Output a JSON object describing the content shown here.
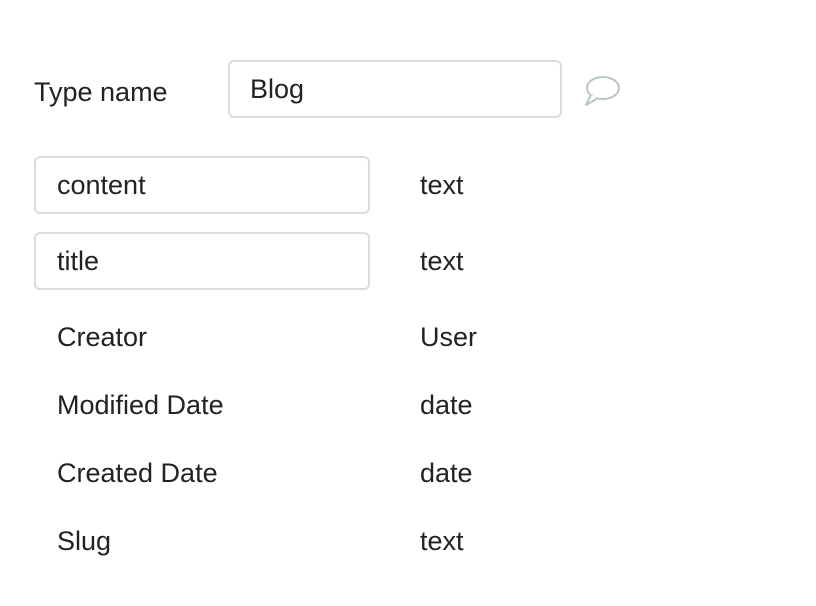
{
  "type_name": {
    "label": "Type name",
    "value": "Blog"
  },
  "icons": {
    "comment": "speech-bubble-icon"
  },
  "editable_fields": [
    {
      "name": "content",
      "type": "text"
    },
    {
      "name": "title",
      "type": "text"
    }
  ],
  "builtin_fields": [
    {
      "name": "Creator",
      "type": "User"
    },
    {
      "name": "Modified Date",
      "type": "date"
    },
    {
      "name": "Created Date",
      "type": "date"
    },
    {
      "name": "Slug",
      "type": "text"
    }
  ]
}
